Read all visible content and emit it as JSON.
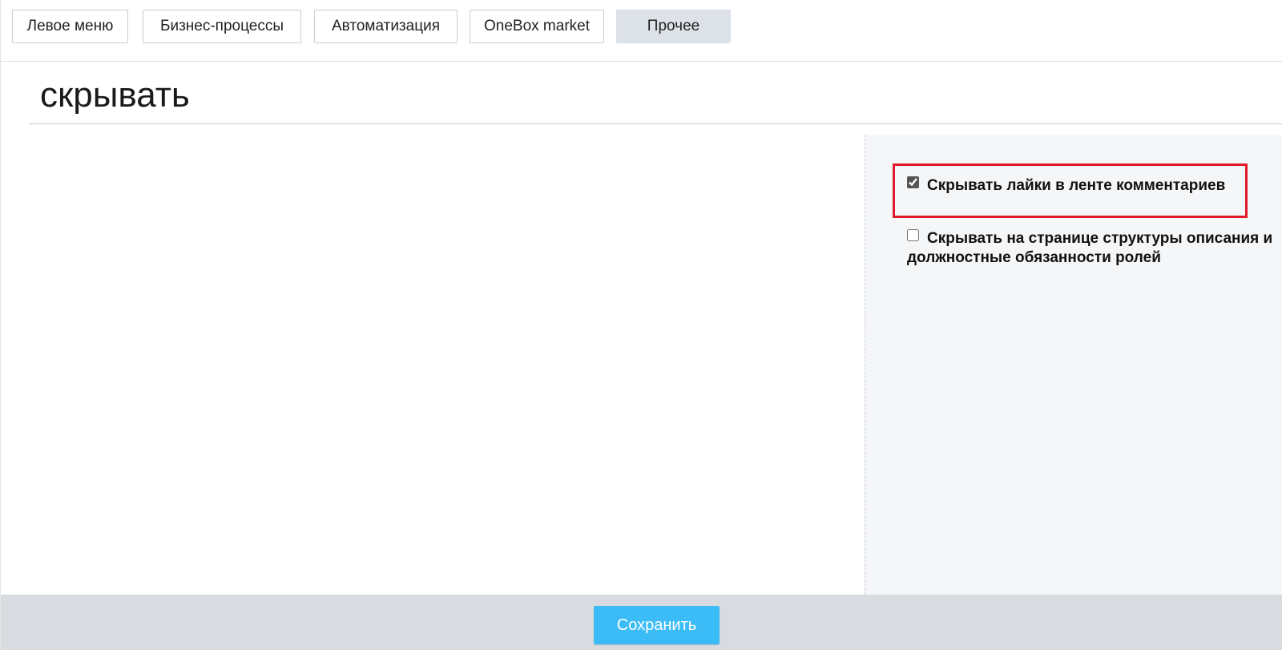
{
  "tabs": [
    {
      "label": "Левое меню",
      "active": false
    },
    {
      "label": "Бизнес-процессы",
      "active": false
    },
    {
      "label": "Автоматизация",
      "active": false
    },
    {
      "label": "OneBox market",
      "active": false
    },
    {
      "label": "Прочее",
      "active": true
    }
  ],
  "search": {
    "value": "скрывать"
  },
  "settings": {
    "options": [
      {
        "label": "Скрывать лайки в ленте комментариев",
        "checked": true,
        "highlighted": true
      },
      {
        "label": "Скрывать на странице структуры описания и должностные обязанности ролей",
        "checked": false,
        "highlighted": false
      }
    ],
    "highlight_color": "#e0192a"
  },
  "footer": {
    "save_label": "Сохранить",
    "save_color": "#3bbcf7"
  }
}
